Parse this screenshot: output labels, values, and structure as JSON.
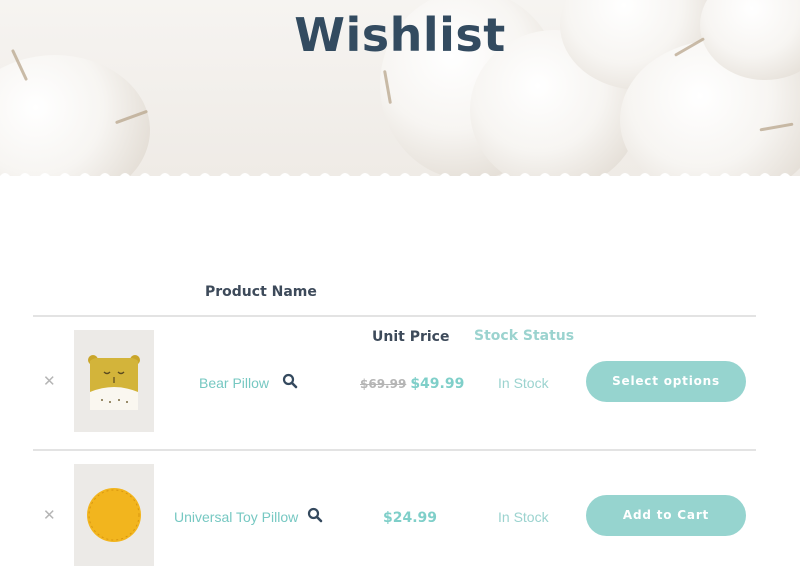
{
  "page": {
    "title": "Wishlist"
  },
  "table": {
    "headers": {
      "product_name": "Product Name",
      "unit_price": "Unit Price",
      "stock_status": "Stock Status"
    },
    "rows": [
      {
        "remove_icon": "close-icon",
        "image": "bear-pillow-image",
        "name": "Bear Pillow",
        "zoom_icon": "search-icon",
        "old_price": "$69.99",
        "price": "$49.99",
        "stock": "In Stock",
        "action": "Select options"
      },
      {
        "remove_icon": "close-icon",
        "image": "universal-toy-pillow-image",
        "name": "Universal Toy Pillow",
        "zoom_icon": "search-icon",
        "old_price": "",
        "price": "$24.99",
        "stock": "In Stock",
        "action": "Add to Cart"
      }
    ]
  },
  "colors": {
    "title": "#334b60",
    "accent": "#96d4cf",
    "link": "#76c8c2",
    "muted": "#b5b5b5"
  }
}
